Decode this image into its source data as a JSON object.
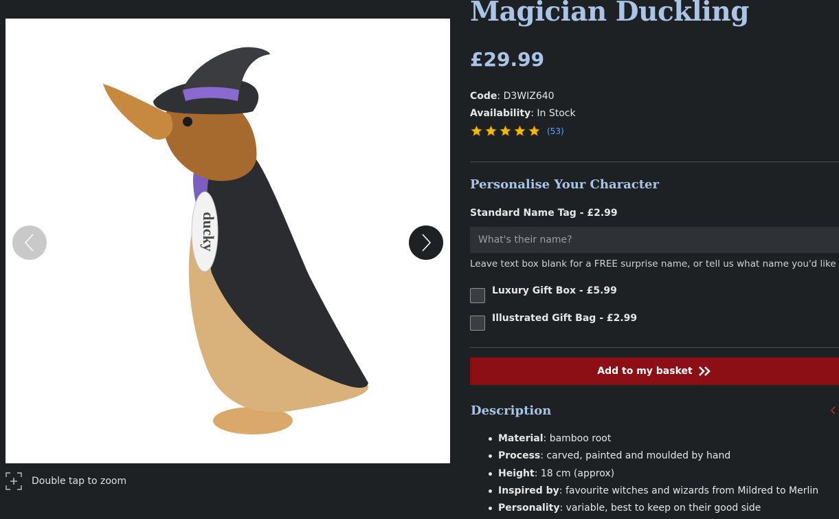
{
  "gallery": {
    "product_image_alt": "Magician Duckling figurine",
    "zoom_hint": "Double tap to zoom",
    "tag_text": "ducky"
  },
  "product": {
    "title": "Magician Duckling",
    "price": "£29.99",
    "code_label": "Code",
    "code": "D3WIZ640",
    "availability_label": "Availability",
    "availability": "In Stock",
    "rating_stars": 5,
    "review_count": "(53)"
  },
  "personalise": {
    "heading": "Personalise Your Character",
    "name_tag_label": "Standard Name Tag - £2.99",
    "name_placeholder": "What's their name?",
    "name_value": "",
    "hint": "Leave text box blank for a FREE surprise name, or tell us what name you'd like",
    "options": [
      {
        "label": "Luxury Gift Box - £5.99",
        "checked": false
      },
      {
        "label": "Illustrated Gift Bag - £2.99",
        "checked": false
      }
    ]
  },
  "basket": {
    "label": "Add to my basket"
  },
  "description": {
    "heading": "Description",
    "items": [
      {
        "key": "Material",
        "value": "bamboo root"
      },
      {
        "key": "Process",
        "value": "carved, painted and moulded by hand"
      },
      {
        "key": "Height",
        "value": "18 cm (approx)"
      },
      {
        "key": "Inspired by",
        "value": "favourite witches and wizards from Mildred to Merlin"
      },
      {
        "key": "Personality",
        "value": "variable, best to keep on their good side"
      }
    ]
  },
  "colors": {
    "background": "#1e2124",
    "accent_heading": "#a9c4e6",
    "basket_button": "#8b0f14",
    "star": "#f5b800",
    "review_link": "#5aa7ff"
  }
}
